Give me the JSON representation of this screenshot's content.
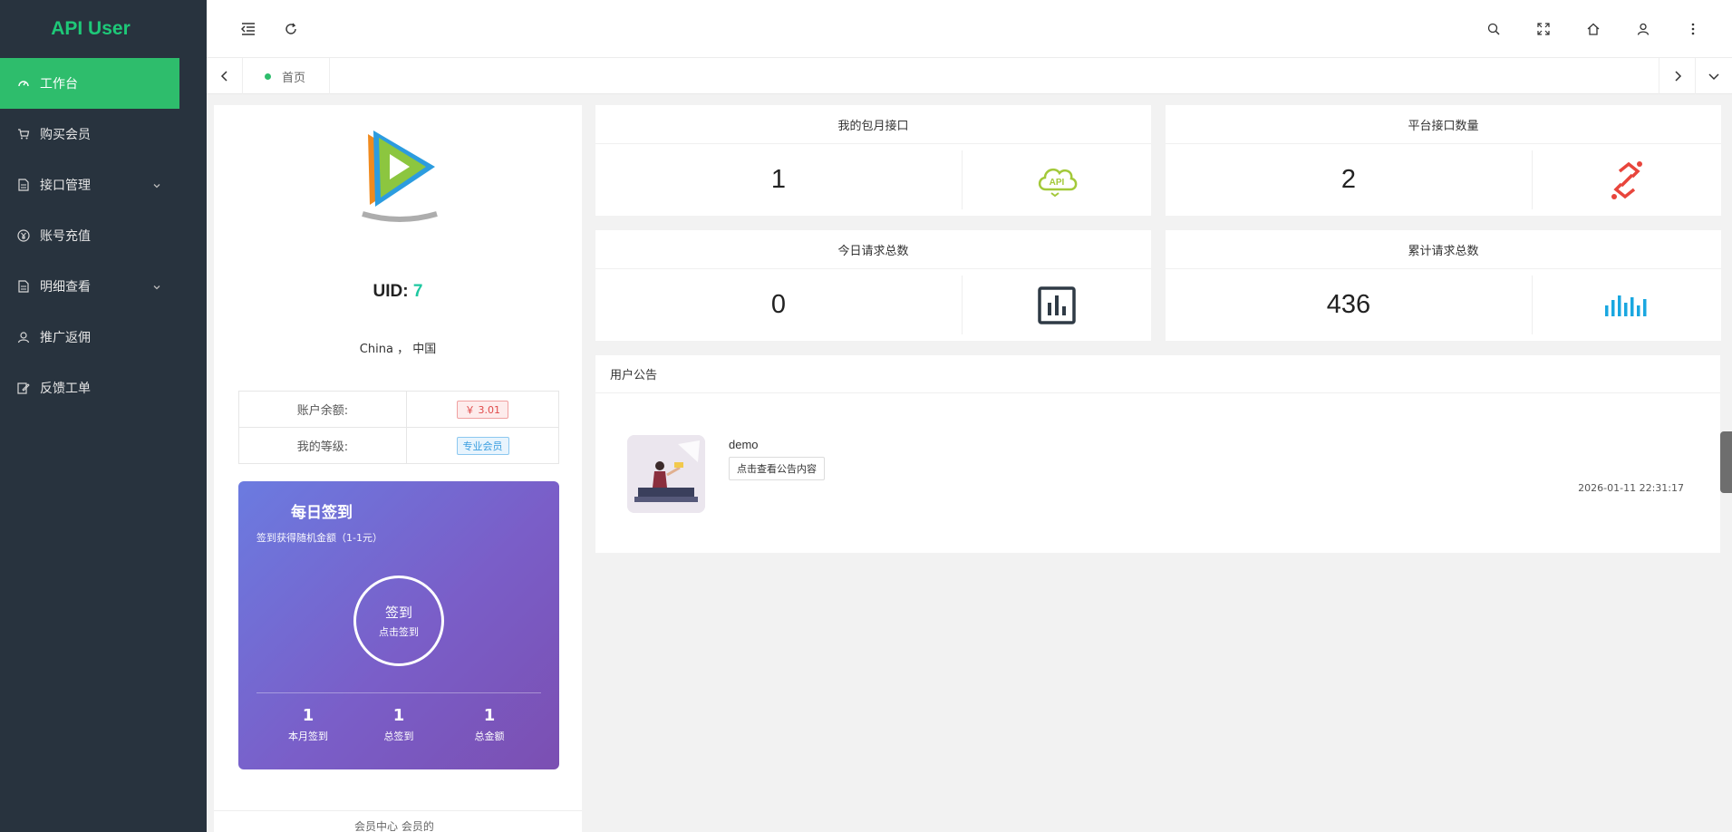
{
  "sidebar": {
    "logo": "API User",
    "items": [
      {
        "label": "工作台",
        "icon": "dashboard-icon"
      },
      {
        "label": "购买会员",
        "icon": "cart-icon"
      },
      {
        "label": "接口管理",
        "icon": "document-icon"
      },
      {
        "label": "账号充值",
        "icon": "yen-icon"
      },
      {
        "label": "明细查看",
        "icon": "document-icon"
      },
      {
        "label": "推广返佣",
        "icon": "user-icon"
      },
      {
        "label": "反馈工单",
        "icon": "edit-icon"
      }
    ]
  },
  "tabs": {
    "home": "首页"
  },
  "profile": {
    "uid_label": "UID:",
    "uid": "7",
    "location": "China ， 中国",
    "balance_label": "账户余额:",
    "balance": "￥ 3.01",
    "level_label": "我的等级:",
    "level": "专业会员",
    "bottom_partial": "会员中心 会员的"
  },
  "signin": {
    "title": "每日签到",
    "subtitle": "签到获得随机金额（1-1元）",
    "button_main": "签到",
    "button_sub": "点击签到",
    "stats": [
      {
        "value": "1",
        "label": "本月签到"
      },
      {
        "value": "1",
        "label": "总签到"
      },
      {
        "value": "1",
        "label": "总金额"
      }
    ]
  },
  "cards": [
    {
      "title": "我的包月接口",
      "value": "1",
      "icon": "api-cloud-icon",
      "color": "#a3c93a"
    },
    {
      "title": "平台接口数量",
      "value": "2",
      "icon": "link-icon",
      "color": "#e8453c"
    },
    {
      "title": "今日请求总数",
      "value": "0",
      "icon": "bar-chart-icon",
      "color": "#2f3a45"
    },
    {
      "title": "累计请求总数",
      "value": "436",
      "icon": "wave-bars-icon",
      "color": "#1aa7e0"
    }
  ],
  "notice": {
    "heading": "用户公告",
    "title": "demo",
    "button": "点击查看公告内容",
    "date": "2026-01-11 22:31:17"
  }
}
